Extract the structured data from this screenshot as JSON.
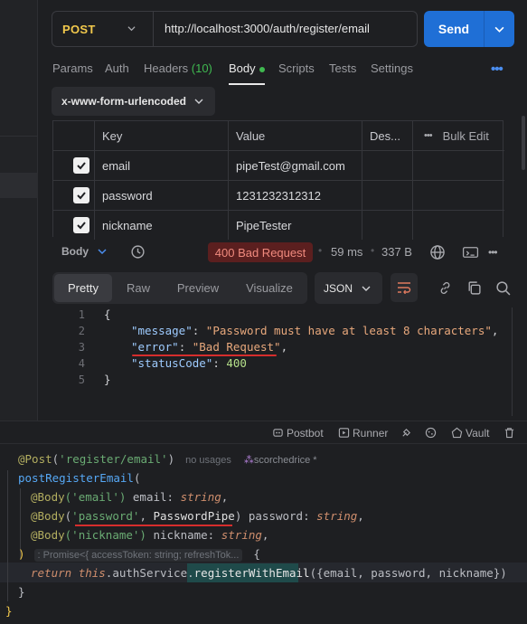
{
  "request": {
    "method": "POST",
    "url": "http://localhost:3000/auth/register/email",
    "send_label": "Send"
  },
  "tabs": {
    "params": "Params",
    "auth": "Auth",
    "headers": "Headers",
    "headers_count": "(10)",
    "body": "Body",
    "scripts": "Scripts",
    "tests": "Tests",
    "settings": "Settings",
    "more": "•••"
  },
  "body_type": "x-www-form-urlencoded",
  "table": {
    "headers": {
      "key": "Key",
      "value": "Value",
      "desc": "Des...",
      "bulk_edit": "Bulk Edit"
    },
    "rows": [
      {
        "key": "email",
        "value": "pipeTest@gmail.com",
        "checked": true
      },
      {
        "key": "password",
        "value": "1231232312312",
        "checked": true
      },
      {
        "key": "nickname",
        "value": "PipeTester",
        "checked": true
      }
    ]
  },
  "response": {
    "body_label": "Body",
    "status": "400 Bad Request",
    "time": "59 ms",
    "size": "337 B",
    "more": "•••",
    "views": [
      "Pretty",
      "Raw",
      "Preview",
      "Visualize"
    ],
    "format": "JSON",
    "lines": [
      "1",
      "2",
      "3",
      "4",
      "5"
    ],
    "open_brace": "{",
    "close_brace": "}",
    "message_key": "\"message\"",
    "message_val": "\"Password must have at least 8 characters\"",
    "error_key": "\"error\"",
    "error_val": "\"Bad Request\"",
    "status_key": "\"statusCode\"",
    "status_val": "400"
  },
  "footer": {
    "postbot": "Postbot",
    "runner": "Runner",
    "vault": "Vault"
  },
  "ide": {
    "decorator": "@Post",
    "route": "('register/email')",
    "usages": "no usages",
    "author": "scorchedrice *",
    "fn_name": "postRegisterEmail",
    "open_paren": "(",
    "body_anno": "@Body",
    "email_str": "('email')",
    "email_param": " email: ",
    "string_type": "string",
    "comma": ",",
    "password_str_open": "(",
    "password_str": "'password'",
    "password_sep": ", ",
    "password_pipe": "PasswordPipe",
    "password_close": ")",
    "password_param": " password: ",
    "nickname_str": "('nickname')",
    "nickname_param": " nickname: ",
    "close_paren": ")",
    "return_hint": ": Promise<{ accessToken: string; refreshTok...",
    "open_block": "{",
    "return_kw": "return",
    "this_kw": "this",
    "service": ".authService.",
    "method": "registerWithEmail",
    "args": "({email, password, nickname})",
    "inner_close": "}",
    "outer_close": "}"
  }
}
